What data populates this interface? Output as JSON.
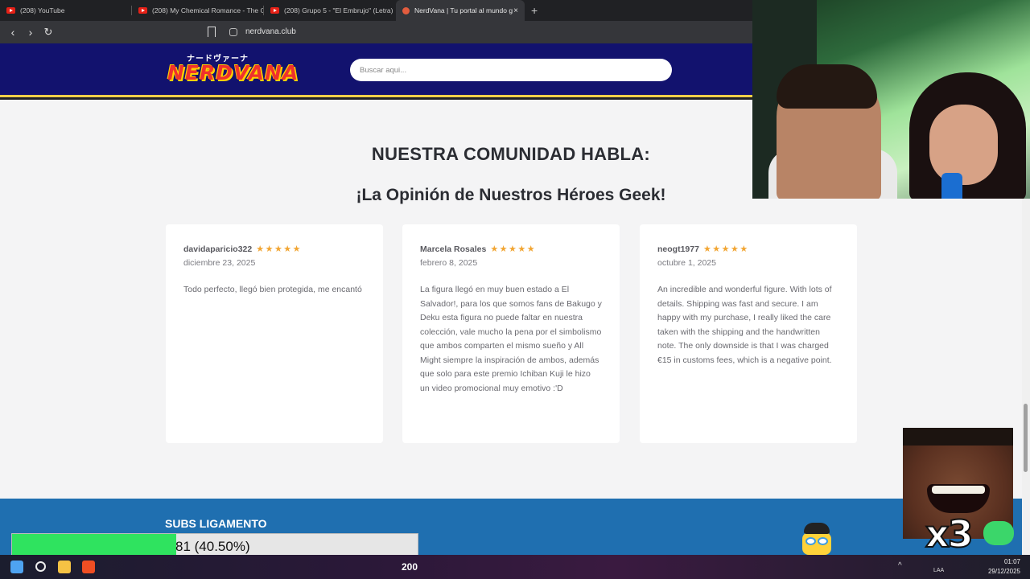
{
  "browser": {
    "tabs": [
      {
        "title": "(208) YouTube"
      },
      {
        "title": "(208) My Chemical Romance - The Gl"
      },
      {
        "title": "(208) Grupo 5 - \"El Embrujo\" (Letra)"
      },
      {
        "title": "NerdVana | Tu portal al mundo g"
      }
    ],
    "active_tab_close": "×",
    "new_tab": "+",
    "nav": {
      "back": "‹",
      "forward": "›",
      "reload": "↻"
    },
    "url": "nerdvana.club"
  },
  "site": {
    "logo_jp": "ナードヴァーナ",
    "logo_main": "NERDVANA",
    "search_placeholder": "Buscar aqui..."
  },
  "testimonials": {
    "heading": "NUESTRA COMUNIDAD HABLA:",
    "subheading": "¡La Opinión de Nuestros Héroes Geek!",
    "reviews": [
      {
        "name": "davidaparicio322",
        "stars": "★★★★★",
        "rating": 5,
        "date": "diciembre 23, 2025",
        "text": "Todo perfecto, llegó bien protegida, me encantó"
      },
      {
        "name": "Marcela Rosales",
        "stars": "★★★★★",
        "rating": 5,
        "date": "febrero 8, 2025",
        "text": "La figura llegó en muy buen estado a El Salvador!, para los que somos fans de Bakugo y Deku esta figura no puede faltar en nuestra colección, vale mucho la pena por el simbolismo que ambos comparten el mismo sueño y All Might siempre la inspiración de ambos, además que solo para este premio Ichiban Kuji le hizo un video promocional muy emotivo :'D"
      },
      {
        "name": "neogt1977",
        "stars": "★★★★★",
        "rating": 5,
        "date": "octubre 1, 2025",
        "text": "An incredible and wonderful figure. With lots of details. Shipping was fast and secure. I am happy with my purchase, I really liked the care taken with the shipping and the handwritten note. The only downside is that I was charged €15 in customs fees, which is a negative point."
      }
    ]
  },
  "overlay": {
    "subs_label": "SUBS LIGAMENTO",
    "progress_text": "81 (40.50%)",
    "progress_fraction": 0.405,
    "meme_text": "x3"
  },
  "taskbar": {
    "count": "200",
    "lang": "LAA",
    "time": "01:07",
    "date": "29/12/2025",
    "tray": "^"
  },
  "colors": {
    "header_bg": "#12126e",
    "star": "#f2a634",
    "progress_fill": "#2fe35f",
    "bottom_section": "#1f6fb0"
  }
}
